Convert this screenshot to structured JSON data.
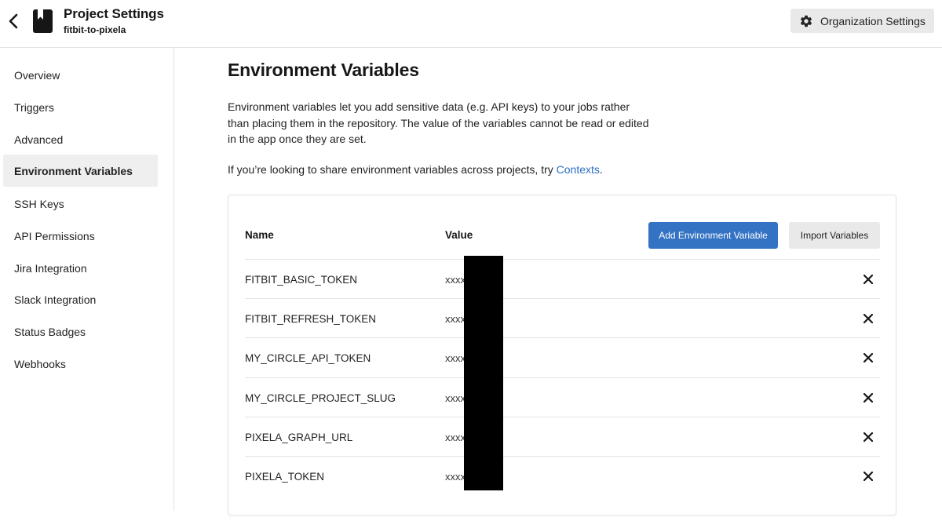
{
  "header": {
    "title": "Project Settings",
    "project_name": "fitbit-to-pixela",
    "org_settings_label": "Organization Settings"
  },
  "sidebar": {
    "items": [
      {
        "label": "Overview",
        "active": false
      },
      {
        "label": "Triggers",
        "active": false
      },
      {
        "label": "Advanced",
        "active": false
      },
      {
        "label": "Environment Variables",
        "active": true
      },
      {
        "label": "SSH Keys",
        "active": false
      },
      {
        "label": "API Permissions",
        "active": false
      },
      {
        "label": "Jira Integration",
        "active": false
      },
      {
        "label": "Slack Integration",
        "active": false
      },
      {
        "label": "Status Badges",
        "active": false
      },
      {
        "label": "Webhooks",
        "active": false
      }
    ]
  },
  "main": {
    "title": "Environment Variables",
    "description": "Environment variables let you add sensitive data (e.g. API keys) to your jobs rather than placing them in the repository. The value of the variables cannot be read or edited in the app once they are set.",
    "share_prefix": "If you’re looking to share environment variables across projects, try ",
    "share_link": "Contexts",
    "share_suffix": "."
  },
  "table": {
    "headers": {
      "name": "Name",
      "value": "Value"
    },
    "add_button": "Add Environment Variable",
    "import_button": "Import Variables",
    "rows": [
      {
        "name": "FITBIT_BASIC_TOKEN",
        "value": "xxxx"
      },
      {
        "name": "FITBIT_REFRESH_TOKEN",
        "value": "xxxx"
      },
      {
        "name": "MY_CIRCLE_API_TOKEN",
        "value": "xxxx"
      },
      {
        "name": "MY_CIRCLE_PROJECT_SLUG",
        "value": "xxxx"
      },
      {
        "name": "PIXELA_GRAPH_URL",
        "value": "xxxx"
      },
      {
        "name": "PIXELA_TOKEN",
        "value": "xxxx"
      }
    ]
  },
  "colors": {
    "primary_button": "#3473c4",
    "link": "#2b6ec7",
    "active_nav_bg": "#efefef",
    "redaction": "#000000"
  },
  "icons": {
    "back": "chevron-left-icon",
    "project": "bookmark-icon",
    "org_settings": "gear-icon",
    "delete": "close-icon"
  }
}
